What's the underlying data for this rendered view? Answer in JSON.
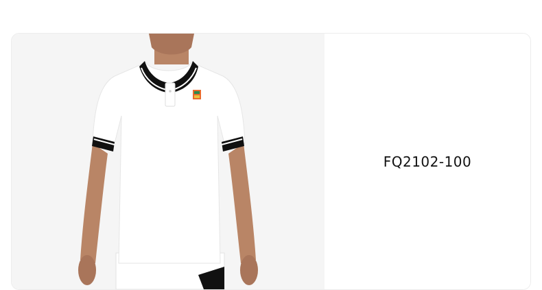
{
  "product": {
    "sku": "FQ2102-100",
    "image_icon": "polo-shirt-model-image",
    "colors": {
      "image_background": "#f5f5f5",
      "shirt": "#ffffff",
      "trim": "#111111",
      "skin": "#b98566"
    }
  }
}
